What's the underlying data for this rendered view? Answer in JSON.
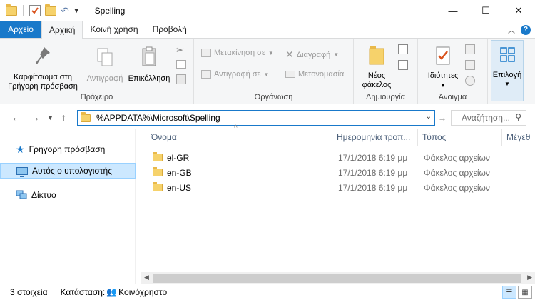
{
  "window": {
    "title": "Spelling",
    "minimize": "—",
    "maximize": "☐",
    "close": "✕"
  },
  "ribbon_tabs": [
    {
      "label": "Αρχείο"
    },
    {
      "label": "Αρχική"
    },
    {
      "label": "Κοινή χρήση"
    },
    {
      "label": "Προβολή"
    }
  ],
  "ribbon": {
    "clipboard": {
      "pin_label": "Καρφίτσωμα στη Γρήγορη πρόσβαση",
      "copy_label": "Αντιγραφή",
      "paste_label": "Επικόλληση",
      "group_label": "Πρόχειρο"
    },
    "organize": {
      "move_label": "Μετακίνηση σε",
      "copy_to_label": "Αντιγραφή σε",
      "delete_label": "Διαγραφή",
      "rename_label": "Μετονομασία",
      "group_label": "Οργάνωση"
    },
    "new": {
      "new_folder_label": "Νέος φάκελος",
      "group_label": "Δημιουργία"
    },
    "open": {
      "properties_label": "Ιδιότητες",
      "group_label": "Άνοιγμα"
    },
    "select": {
      "select_label": "Επιλογή"
    }
  },
  "navigation": {
    "address": "%APPDATA%\\Microsoft\\Spelling",
    "search_placeholder": "Αναζήτηση..."
  },
  "sidebar": {
    "items": [
      {
        "label": "Γρήγορη πρόσβαση",
        "icon": "star-icon"
      },
      {
        "label": "Αυτός ο υπολογιστής",
        "icon": "computer-icon",
        "selected": true
      },
      {
        "label": "Δίκτυο",
        "icon": "network-icon"
      }
    ]
  },
  "columns": [
    "Όνομα",
    "Ημερομηνία τροπ...",
    "Τύπος",
    "Μέγεθ"
  ],
  "files": [
    {
      "name": "el-GR",
      "date": "17/1/2018 6:19 μμ",
      "type": "Φάκελος αρχείων"
    },
    {
      "name": "en-GB",
      "date": "17/1/2018 6:19 μμ",
      "type": "Φάκελος αρχείων"
    },
    {
      "name": "en-US",
      "date": "17/1/2018 6:19 μμ",
      "type": "Φάκελος αρχείων"
    }
  ],
  "status": {
    "item_count": "3 στοιχεία",
    "state_label": "Κατάσταση:",
    "state_value": "Κοινόχρηστο"
  }
}
